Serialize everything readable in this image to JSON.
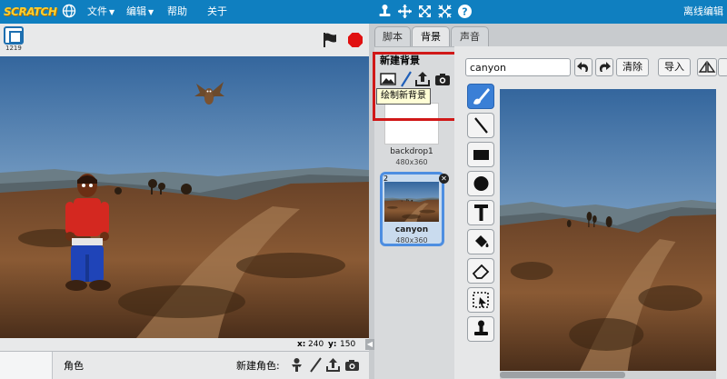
{
  "menubar": {
    "logo": "SCRATCH",
    "items": [
      "文件",
      "编辑",
      "帮助",
      "关于"
    ],
    "right_label": "离线编辑"
  },
  "stage": {
    "version": "1219",
    "x_label": "x:",
    "x_value": "240",
    "y_label": "y:",
    "y_value": "150"
  },
  "sprites": {
    "label": "角色",
    "new_sprite_label": "新建角色:"
  },
  "tabs": [
    "脚本",
    "背景",
    "声音"
  ],
  "backdrops": {
    "new_backdrop_title": "新建背景",
    "tooltip": "绘制新背景",
    "items": [
      {
        "number": "1",
        "name": "backdrop1",
        "size": "480x360"
      },
      {
        "number": "2",
        "name": "canyon",
        "size": "480x360"
      }
    ]
  },
  "editor": {
    "costume_name": "canyon",
    "clear_label": "清除",
    "import_label": "导入"
  },
  "colors": {
    "menubar": "#0f7fc0",
    "highlight": "#d01818",
    "selected": "#4d8ee1"
  }
}
